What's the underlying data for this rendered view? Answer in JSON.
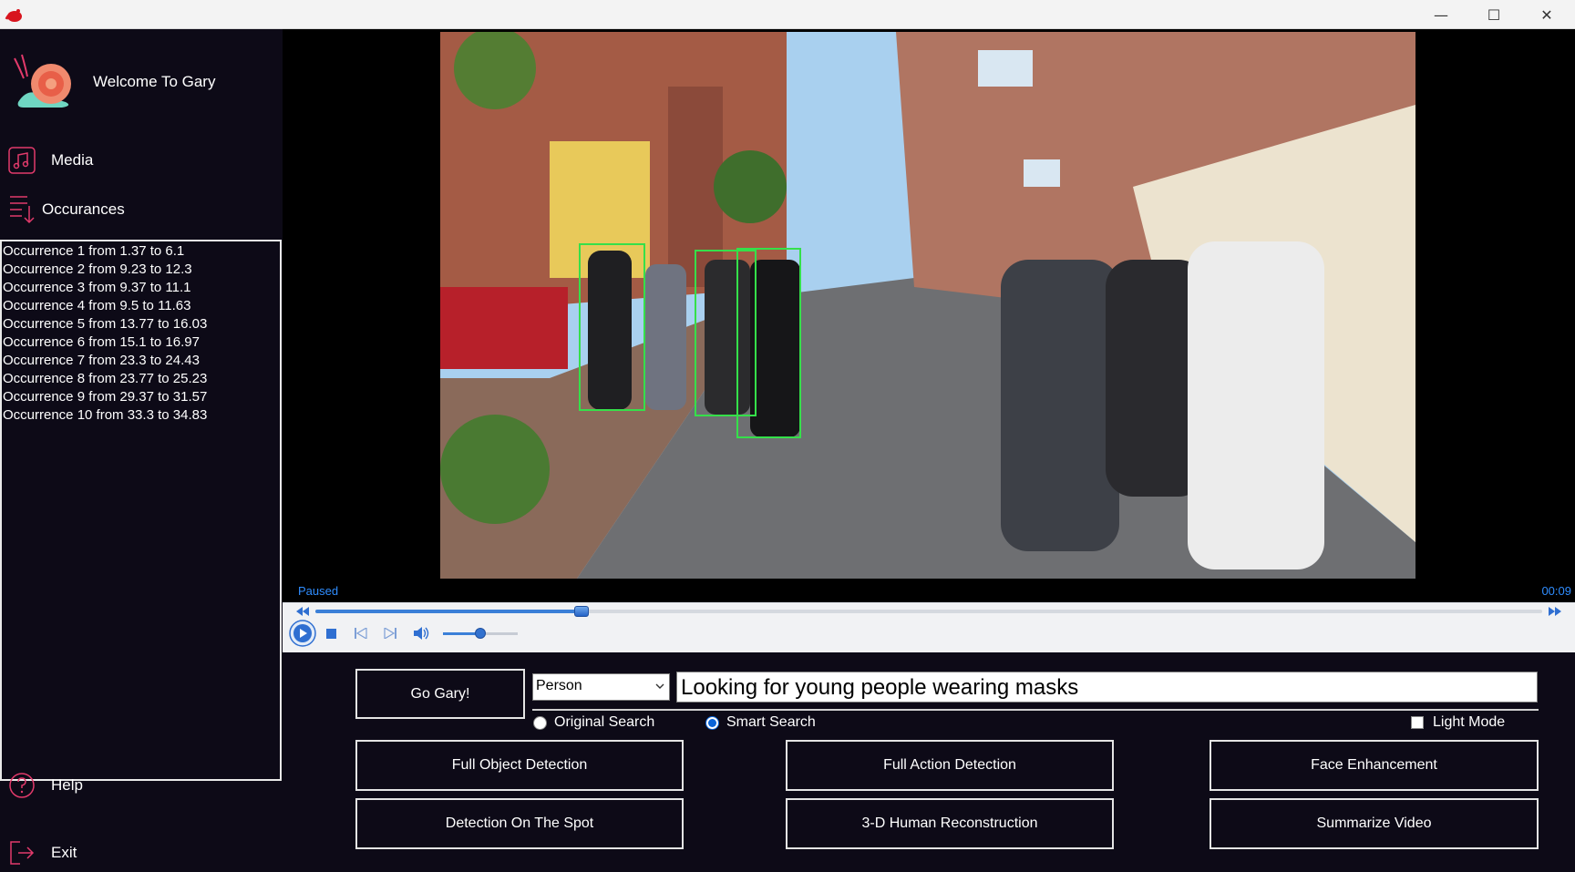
{
  "window": {
    "minimize_glyph": "—",
    "maximize_glyph": "☐",
    "close_glyph": "✕"
  },
  "sidebar": {
    "welcome": "Welcome To Gary",
    "nav": {
      "media": "Media",
      "occurrences": "Occurances",
      "help": "Help",
      "exit": "Exit"
    },
    "occurrences": [
      "Occurrence 1 from 1.37 to 6.1",
      "Occurrence 2 from 9.23 to 12.3",
      "Occurrence 3 from 9.37 to 11.1",
      "Occurrence 4 from 9.5 to 11.63",
      "Occurrence 5 from 13.77 to 16.03",
      "Occurrence 6 from 15.1 to 16.97",
      "Occurrence 7 from 23.3 to 24.43",
      "Occurrence 8 from 23.77 to 25.23",
      "Occurrence 9 from 29.37 to 31.57",
      "Occurrence 10 from 33.3 to 34.83"
    ]
  },
  "player": {
    "status": "Paused",
    "time": "00:09",
    "progress": 0.217,
    "volume": 0.5
  },
  "search": {
    "go_label": "Go Gary!",
    "category": "Person",
    "query": "Looking for young people wearing masks",
    "mode_original": "Original Search",
    "mode_smart": "Smart Search",
    "light_mode": "Light Mode"
  },
  "actions": {
    "full_object": "Full Object Detection",
    "full_action": "Full Action Detection",
    "face_enhancement": "Face Enhancement",
    "detection_spot": "Detection On The Spot",
    "reconstruction": "3-D Human Reconstruction",
    "summarize": "Summarize Video"
  },
  "colors": {
    "accent": "#e23a6b",
    "detection_box": "#35e04a",
    "status_text": "#2f8dff"
  }
}
